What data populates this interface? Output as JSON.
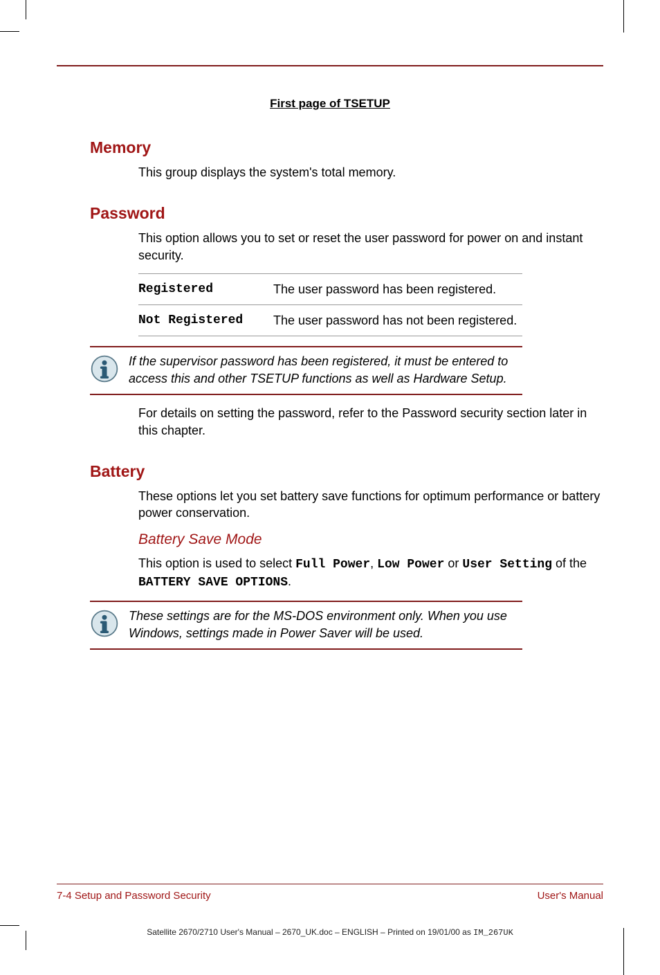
{
  "figure_heading": "First page of TSETUP",
  "memory": {
    "heading": "Memory",
    "para": "This group displays the system's total memory."
  },
  "password": {
    "heading": "Password",
    "para": "This option allows you to set or reset the user password for power on and instant security.",
    "rows": [
      {
        "k": "Registered",
        "v": "The user password has been registered."
      },
      {
        "k": "Not Registered",
        "v": "The user password has not been registered."
      }
    ],
    "note": "If the supervisor password has been registered, it must be entered to access this and other TSETUP functions as well as Hardware Setup.",
    "after_note": "For details on setting the password, refer to the Password security section later in this chapter."
  },
  "battery": {
    "heading": "Battery",
    "para": "These options let you set battery save functions for optimum performance or battery power conservation.",
    "sub_heading": "Battery Save Mode",
    "p2a": "This option is used to select ",
    "p2b": "Full Power",
    "p2c": ", ",
    "p2d": "Low Power",
    "p2e": " or ",
    "p2f": "User Setting",
    "p2g": " of the ",
    "p2h": "BATTERY SAVE OPTIONS",
    "p2i": ".",
    "note": "These settings are for the MS-DOS environment only. When you use Windows, settings made in Power Saver will be used."
  },
  "footer": {
    "left": "7-4  Setup and Password Security",
    "right": "User's Manual"
  },
  "printline": {
    "a": "Satellite 2670/2710 User's Manual  – 2670_UK.doc – ENGLISH – Printed on 19/01/00 as ",
    "b": "IM_267UK"
  },
  "icons": {
    "info": "info-icon"
  }
}
